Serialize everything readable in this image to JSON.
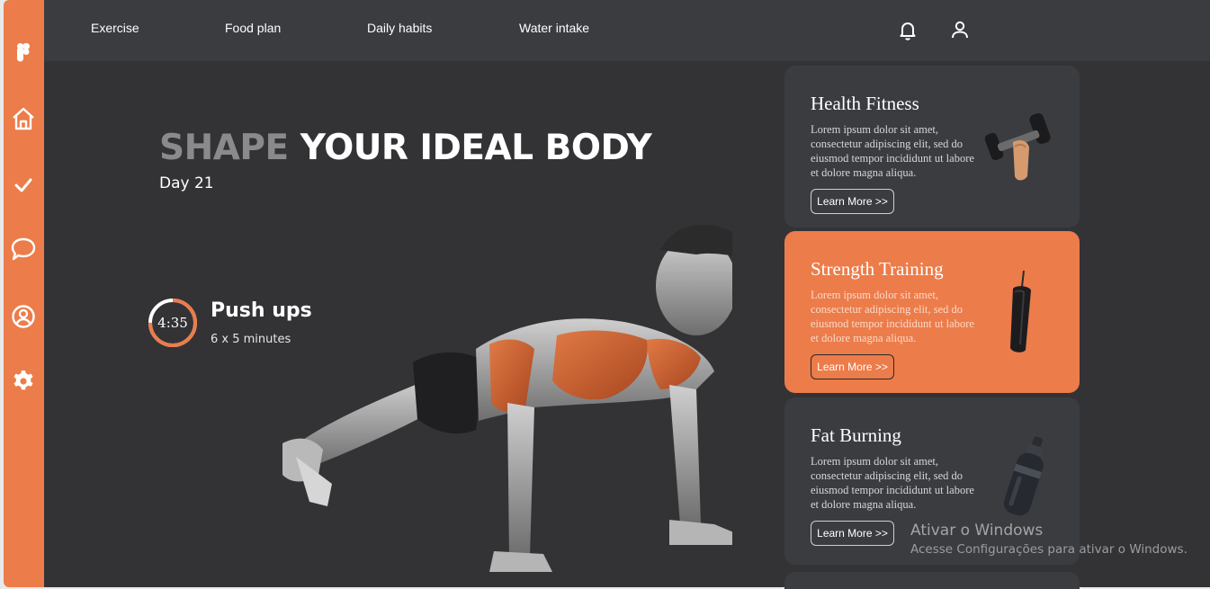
{
  "sidebar": {
    "items": [
      {
        "icon": "figma-logo-icon"
      },
      {
        "icon": "home-icon"
      },
      {
        "icon": "check-icon"
      },
      {
        "icon": "chat-icon"
      },
      {
        "icon": "profile-icon"
      },
      {
        "icon": "settings-gear-icon"
      }
    ]
  },
  "nav": {
    "items": [
      "Exercise",
      "Food plan",
      "Daily habits",
      "Water intake"
    ],
    "icons": [
      "bell-icon",
      "user-icon"
    ]
  },
  "hero": {
    "title_muted": "SHAPE",
    "title_bright": "YOUR IDEAL BODY",
    "day": "Day 21"
  },
  "exercise": {
    "timer": "4:35",
    "timer_progress": 0.75,
    "name": "Push ups",
    "reps": "6 x 5 minutes"
  },
  "cards": [
    {
      "title": "Health Fitness",
      "description": "Lorem ipsum dolor sit amet, consectetur adipiscing elit, sed do eiusmod tempor incididunt ut labore et dolore magna aliqua.",
      "button": "Learn More >>",
      "image": "dumbbell-icon"
    },
    {
      "title": "Strength Training",
      "description": "Lorem ipsum dolor sit amet, consectetur adipiscing elit, sed do eiusmod tempor incididunt ut labore et dolore magna aliqua.",
      "button": "Learn More >>",
      "image": "punching-bag-icon"
    },
    {
      "title": "Fat Burning",
      "description": "Lorem ipsum dolor sit amet, consectetur adipiscing elit, sed do eiusmod tempor incididunt ut labore et dolore magna aliqua.",
      "button": "Learn More >>",
      "image": "water-bottle-icon"
    }
  ],
  "watermark": {
    "line1": "Ativar o Windows",
    "line2": "Acesse Configurações para ativar o Windows."
  },
  "colors": {
    "accent": "#ec7c4a",
    "background": "#333336",
    "panel": "#3a3c40",
    "text": "#ffffff"
  }
}
